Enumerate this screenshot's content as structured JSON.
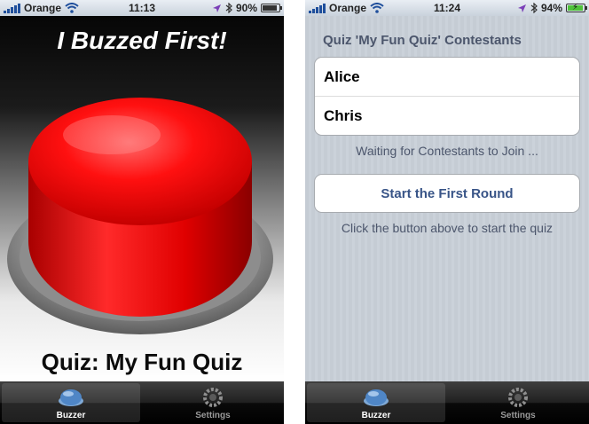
{
  "left_screen": {
    "status_bar": {
      "carrier": "Orange",
      "time": "11:13",
      "battery": "90%",
      "battery_level": 0.9
    },
    "headline": "I Buzzed First!",
    "quiz_title": "Quiz: My Fun Quiz",
    "tabs": [
      {
        "label": "Buzzer",
        "selected": true
      },
      {
        "label": "Settings",
        "selected": false
      }
    ]
  },
  "right_screen": {
    "status_bar": {
      "carrier": "Orange",
      "time": "11:24",
      "battery": "94%",
      "battery_level": 0.94,
      "charging": true
    },
    "section_title": "Quiz 'My Fun Quiz' Contestants",
    "contestants": [
      "Alice",
      "Chris"
    ],
    "waiting_text": "Waiting for Contestants to Join ...",
    "start_button_label": "Start the First Round",
    "instruction_text": "Click the button above to start the quiz",
    "tabs": [
      {
        "label": "Buzzer",
        "selected": true
      },
      {
        "label": "Settings",
        "selected": false
      }
    ]
  },
  "icons": {
    "signal": "signal-bars-icon",
    "wifi": "wifi-icon",
    "location": "location-arrow-icon",
    "bluetooth": "bluetooth-icon",
    "battery": "battery-icon",
    "buzzer_tab": "buzzer-dome-icon",
    "settings_tab": "gear-icon"
  },
  "colors": {
    "buzzer_red": "#ff1a1a",
    "list_text": "#4c566c",
    "button_text": "#385487",
    "charging_green": "#4fc23a"
  }
}
